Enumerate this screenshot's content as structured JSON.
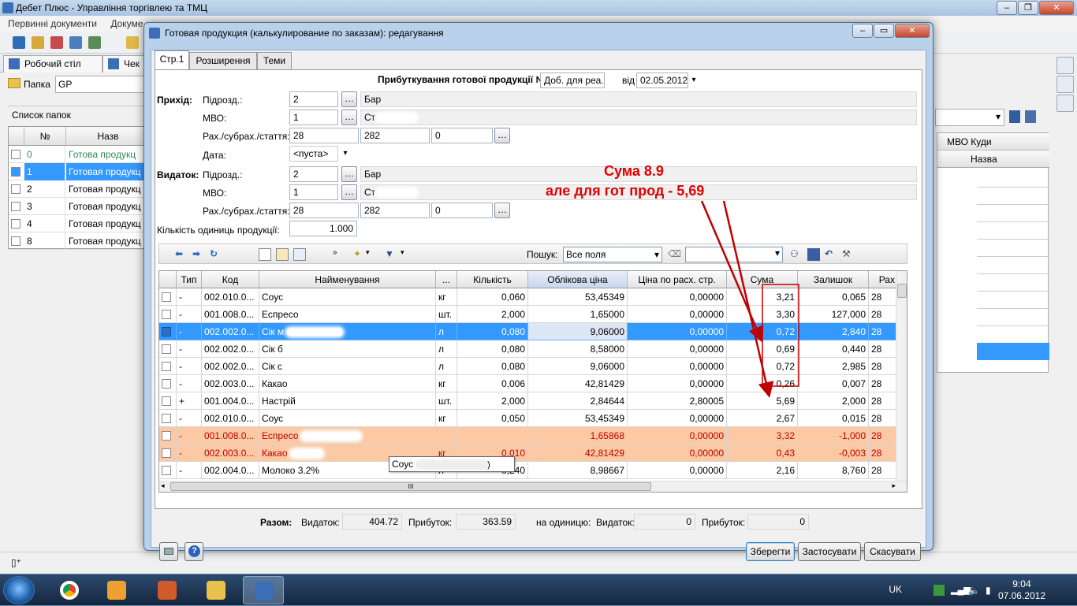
{
  "app": {
    "title": "Дебет Плюс - Управління торгівлею та ТМЦ",
    "menu": [
      "Первинні документи",
      "Докуме"
    ],
    "tabs": [
      {
        "label": "Робочий стіл"
      },
      {
        "label": "Чек М"
      }
    ],
    "folder_label": "Папка",
    "folder_value": "GP",
    "folder_list_title": "Список папок",
    "left_grid": {
      "col_num": "№",
      "col_name": "Назв",
      "rows": [
        {
          "num": "0",
          "name": "Готова продукц"
        },
        {
          "num": "1",
          "name": "Готовая продукц"
        },
        {
          "num": "2",
          "name": "Готовая продукц"
        },
        {
          "num": "3",
          "name": "Готовая продукц"
        },
        {
          "num": "4",
          "name": "Готовая продукц"
        },
        {
          "num": "8",
          "name": "Готовая продукц"
        }
      ]
    },
    "right_grid": {
      "h1": "МВО Куди",
      "h2": "Назва"
    }
  },
  "dialog": {
    "title": "Готовая продукция (калькулирование по заказам): редагування",
    "tabs": [
      "Стр.1",
      "Розширення",
      "Теми"
    ],
    "doc_title": "Прибуткування готової продукції №",
    "doc_number": "Доб. для реа.",
    "from_label": "від",
    "doc_date": "02.05.2012",
    "income": {
      "section": "Прихід:",
      "dept_label": "Підрозд.:",
      "dept_code": "2",
      "dept_name": "Бар",
      "mvo_label": "МВО:",
      "mvo_code": "1",
      "mvo_name": "Ст",
      "account_label": "Рах./субрах./стаття:",
      "account": "28",
      "subaccount": "282",
      "article": "0",
      "date_label": "Дата:",
      "date_value": "<пуста>"
    },
    "expense": {
      "section": "Видаток:",
      "dept_label": "Підрозд.:",
      "dept_code": "2",
      "dept_name": "Бар",
      "mvo_label": "МВО:",
      "mvo_code": "1",
      "mvo_name": "Ст",
      "account_label": "Рах./субрах./стаття:",
      "account": "28",
      "subaccount": "282",
      "article": "0"
    },
    "qty_label": "Кількість одиниць продукції:",
    "qty_value": "1.000",
    "search_label": "Пошук:",
    "search_scope": "Все поля",
    "grid": {
      "columns": [
        "Тип",
        "Код",
        "Найменування",
        "...",
        "Кількість",
        "Облікова ціна",
        "Ціна по расх. стр.",
        "Сума",
        "Залишок",
        "Рах."
      ],
      "rows": [
        {
          "type": "-",
          "code": "002.010.0...",
          "name": "Соус",
          "unit": "кг",
          "qty": "0,060",
          "price": "53,45349",
          "price2": "0,00000",
          "sum": "3,21",
          "rest": "0,065",
          "acc": "28"
        },
        {
          "type": "-",
          "code": "001.008.0...",
          "name": "Еспресо",
          "unit": "шт.",
          "qty": "2,000",
          "price": "1,65000",
          "price2": "0,00000",
          "sum": "3,30",
          "rest": "127,000",
          "acc": "28"
        },
        {
          "type": "-",
          "code": "002.002.0...",
          "name": "Сік м",
          "unit": "л",
          "qty": "0,080",
          "price": "9,06000",
          "price2": "0,00000",
          "sum": "0,72",
          "rest": "2,840",
          "acc": "28"
        },
        {
          "type": "-",
          "code": "002.002.0...",
          "name": "Сік б",
          "unit": "л",
          "qty": "0,080",
          "price": "8,58000",
          "price2": "0,00000",
          "sum": "0,69",
          "rest": "0,440",
          "acc": "28"
        },
        {
          "type": "-",
          "code": "002.002.0...",
          "name": "Сік с",
          "unit": "л",
          "qty": "0,080",
          "price": "9,06000",
          "price2": "0,00000",
          "sum": "0,72",
          "rest": "2,985",
          "acc": "28"
        },
        {
          "type": "-",
          "code": "002.003.0...",
          "name": "Какао",
          "unit": "кг",
          "qty": "0,006",
          "price": "42,81429",
          "price2": "0,00000",
          "sum": "0,26",
          "rest": "0,007",
          "acc": "28"
        },
        {
          "type": "+",
          "code": "001.004.0...",
          "name": "Настрій",
          "unit": "шт.",
          "qty": "2,000",
          "price": "2,84644",
          "price2": "2,80005",
          "sum": "5,69",
          "rest": "2,000",
          "acc": "28"
        },
        {
          "type": "-",
          "code": "002.010.0...",
          "name": "Соус",
          "unit": "кг",
          "qty": "0,050",
          "price": "53,45349",
          "price2": "0,00000",
          "sum": "2,67",
          "rest": "0,015",
          "acc": "28"
        },
        {
          "type": "-",
          "code": "001.008.0...",
          "name": "Еспресо",
          "unit": "",
          "qty": "",
          "price": "1,65868",
          "price2": "0,00000",
          "sum": "3,32",
          "rest": "-1,000",
          "acc": "28"
        },
        {
          "type": "-",
          "code": "002.003.0...",
          "name": "Какао",
          "unit": "кг",
          "qty": "0,010",
          "price": "42,81429",
          "price2": "0,00000",
          "sum": "0,43",
          "rest": "-0,003",
          "acc": "28"
        },
        {
          "type": "-",
          "code": "002.004.0...",
          "name": "Молоко 3.2%",
          "unit": "л",
          "qty": "0,240",
          "price": "8,98667",
          "price2": "0,00000",
          "sum": "2,16",
          "rest": "8,760",
          "acc": "28"
        }
      ]
    },
    "tooltip": "Соус",
    "totals": {
      "label": "Разом:",
      "expense_label": "Видаток:",
      "expense": "404.72",
      "income_label": "Прибуток:",
      "income": "363.59",
      "per_unit_label": "на одиницю:",
      "unit_expense_label": "Видаток:",
      "unit_expense": "0",
      "unit_income_label": "Прибуток:",
      "unit_income": "0"
    },
    "buttons": {
      "save": "Зберегти",
      "apply": "Застосувати",
      "cancel": "Скасувати"
    }
  },
  "annotation": {
    "line1": "Сума 8.9",
    "line2": "але для гот прод - 5,69",
    "color": "#e00000"
  },
  "taskbar": {
    "lang": "UK",
    "time": "9:04",
    "date": "07.06.2012"
  }
}
